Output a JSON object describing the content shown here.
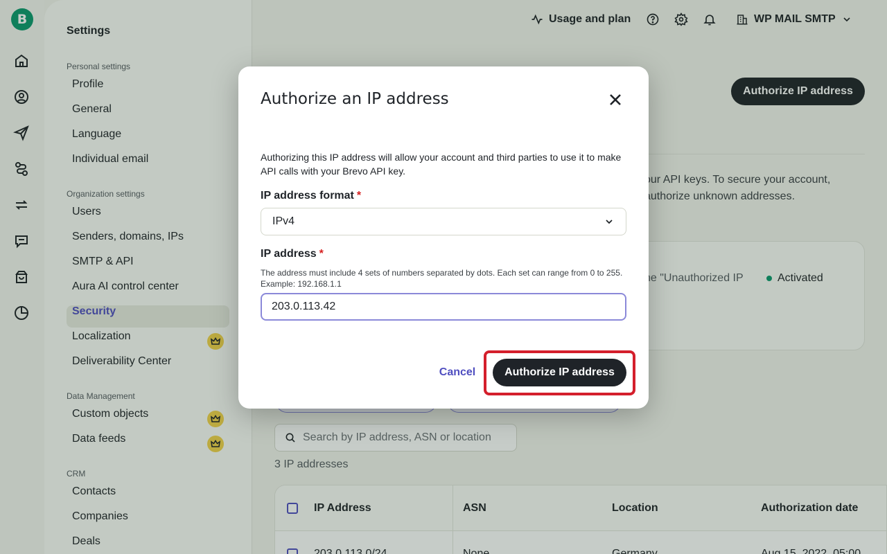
{
  "brand": {
    "logo_letter": "B",
    "accent": "#0b996e"
  },
  "rail": {
    "icons": [
      "home-icon",
      "contacts-icon",
      "campaigns-icon",
      "automations-icon",
      "transactional-icon",
      "conversations-icon",
      "sales-icon",
      "reports-icon"
    ]
  },
  "header": {
    "usage_label": "Usage and plan",
    "account_name": "WP MAIL SMTP"
  },
  "sidebar": {
    "title": "Settings",
    "sections": [
      {
        "title": "Personal settings",
        "items": [
          "Profile",
          "General",
          "Language",
          "Individual email"
        ]
      },
      {
        "title": "Organization settings",
        "items": [
          "Users",
          "Senders, domains, IPs",
          "SMTP & API",
          "Aura AI control center",
          "Security",
          "Localization",
          "Deliverability Center"
        ]
      },
      {
        "title": "Data Management",
        "items": [
          "Custom objects",
          "Data feeds"
        ]
      },
      {
        "title": "CRM",
        "items": [
          "Contacts",
          "Companies",
          "Deals"
        ]
      }
    ],
    "active_item": "Security"
  },
  "main": {
    "authorize_button": "Authorize IP address",
    "description_line1": "our API keys. To secure your account,",
    "description_line2": "authorize unknown addresses.",
    "card_text": "he \"Unauthorized IP",
    "card_status": "Activated",
    "search_placeholder": "Search by IP address, ASN or location",
    "ip_count": "3 IP addresses",
    "table": {
      "columns": [
        "IP Address",
        "ASN",
        "Location",
        "Authorization date"
      ],
      "rows": [
        [
          "203.0.113.0/24",
          "None",
          "Germany",
          "Aug 15, 2022, 05:00"
        ]
      ]
    }
  },
  "modal": {
    "title": "Authorize an IP address",
    "description": "Authorizing this IP address will allow your account and third parties to use it to make API calls with your Brevo API key.",
    "format_label": "IP address format",
    "format_value": "IPv4",
    "ip_label": "IP address",
    "required_mark": "*",
    "ip_hint": "The address must include 4 sets of numbers separated by dots. Each set can range from 0 to 255. Example: 192.168.1.1",
    "ip_value": "203.0.113.42",
    "cancel_label": "Cancel",
    "submit_label": "Authorize IP address"
  }
}
